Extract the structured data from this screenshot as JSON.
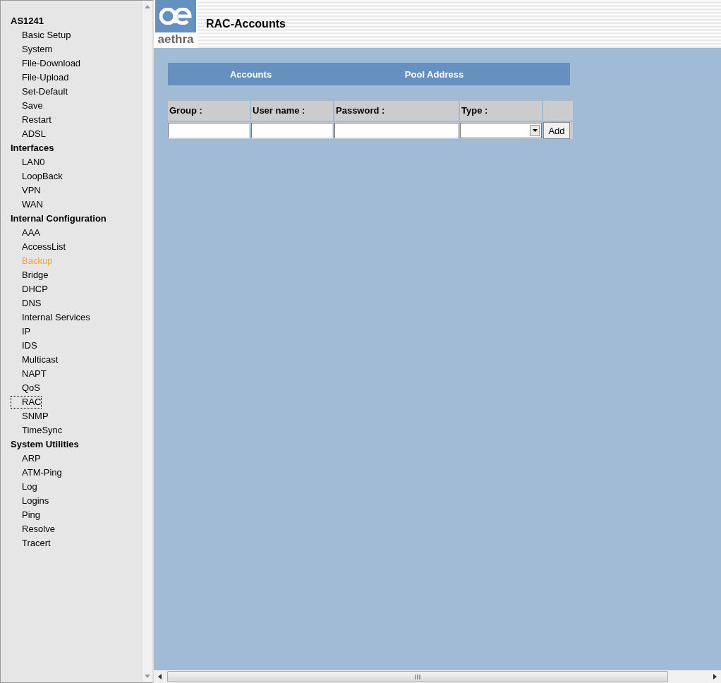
{
  "sidebar": {
    "groups": [
      {
        "title": "AS1241",
        "items": [
          {
            "label": "Basic Setup",
            "highlighted": false,
            "focused": false
          },
          {
            "label": "System",
            "highlighted": false,
            "focused": false
          },
          {
            "label": "File-Download",
            "highlighted": false,
            "focused": false
          },
          {
            "label": "File-Upload",
            "highlighted": false,
            "focused": false
          },
          {
            "label": "Set-Default",
            "highlighted": false,
            "focused": false
          },
          {
            "label": "Save",
            "highlighted": false,
            "focused": false
          },
          {
            "label": "Restart",
            "highlighted": false,
            "focused": false
          },
          {
            "label": "ADSL",
            "highlighted": false,
            "focused": false
          }
        ]
      },
      {
        "title": "Interfaces",
        "items": [
          {
            "label": "LAN0",
            "highlighted": false,
            "focused": false
          },
          {
            "label": "LoopBack",
            "highlighted": false,
            "focused": false
          },
          {
            "label": "VPN",
            "highlighted": false,
            "focused": false
          },
          {
            "label": "WAN",
            "highlighted": false,
            "focused": false
          }
        ]
      },
      {
        "title": "Internal Configuration",
        "items": [
          {
            "label": "AAA",
            "highlighted": false,
            "focused": false
          },
          {
            "label": "AccessList",
            "highlighted": false,
            "focused": false
          },
          {
            "label": "Backup",
            "highlighted": true,
            "focused": false
          },
          {
            "label": "Bridge",
            "highlighted": false,
            "focused": false
          },
          {
            "label": "DHCP",
            "highlighted": false,
            "focused": false
          },
          {
            "label": "DNS",
            "highlighted": false,
            "focused": false
          },
          {
            "label": "Internal Services",
            "highlighted": false,
            "focused": false
          },
          {
            "label": "IP",
            "highlighted": false,
            "focused": false
          },
          {
            "label": "IDS",
            "highlighted": false,
            "focused": false
          },
          {
            "label": "Multicast",
            "highlighted": false,
            "focused": false
          },
          {
            "label": "NAPT",
            "highlighted": false,
            "focused": false
          },
          {
            "label": "QoS",
            "highlighted": false,
            "focused": false
          },
          {
            "label": "RAC",
            "highlighted": false,
            "focused": true
          },
          {
            "label": "SNMP",
            "highlighted": false,
            "focused": false
          },
          {
            "label": "TimeSync",
            "highlighted": false,
            "focused": false
          }
        ]
      },
      {
        "title": "System Utilities",
        "items": [
          {
            "label": "ARP",
            "highlighted": false,
            "focused": false
          },
          {
            "label": "ATM-Ping",
            "highlighted": false,
            "focused": false
          },
          {
            "label": "Log",
            "highlighted": false,
            "focused": false
          },
          {
            "label": "Logins",
            "highlighted": false,
            "focused": false
          },
          {
            "label": "Ping",
            "highlighted": false,
            "focused": false
          },
          {
            "label": "Resolve",
            "highlighted": false,
            "focused": false
          },
          {
            "label": "Tracert",
            "highlighted": false,
            "focused": false
          }
        ]
      }
    ]
  },
  "header": {
    "logo_text": "aethra",
    "title": "RAC-Accounts"
  },
  "tabs": [
    {
      "label": "Accounts"
    },
    {
      "label": "Pool Address"
    }
  ],
  "form": {
    "columns": [
      "Group :",
      "User name :",
      "Password :",
      "Type :"
    ],
    "fields": [
      {
        "kind": "text"
      },
      {
        "kind": "text"
      },
      {
        "kind": "password"
      },
      {
        "kind": "select"
      }
    ],
    "button": "Add"
  }
}
